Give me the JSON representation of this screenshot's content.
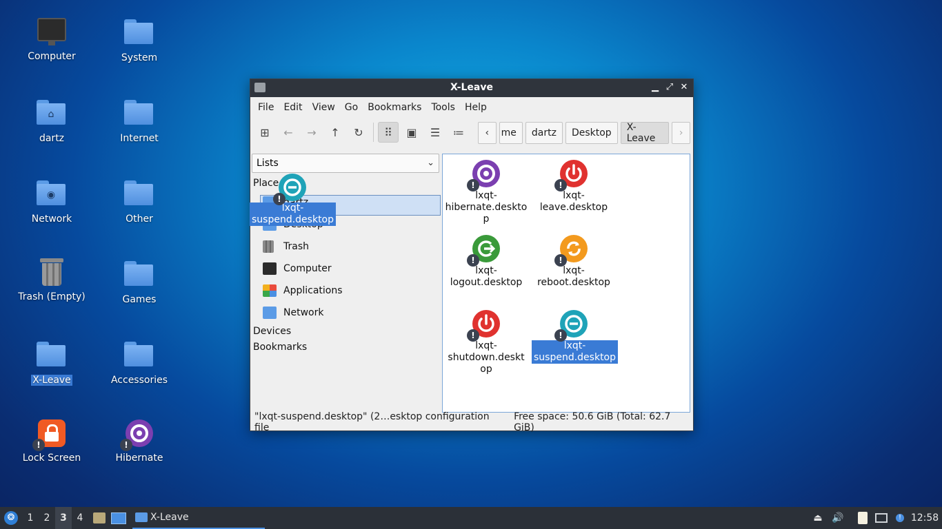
{
  "desktop": {
    "icons": [
      {
        "label": "Computer",
        "icon": "computer-icon"
      },
      {
        "label": "System",
        "icon": "folder-icon"
      },
      {
        "label": "dartz",
        "icon": "home-folder-icon"
      },
      {
        "label": "Internet",
        "icon": "folder-icon"
      },
      {
        "label": "Network",
        "icon": "network-folder-icon"
      },
      {
        "label": "Other",
        "icon": "folder-icon"
      },
      {
        "label": "Trash (Empty)",
        "icon": "trash-icon"
      },
      {
        "label": "Games",
        "icon": "folder-icon"
      },
      {
        "label": "X-Leave",
        "icon": "folder-icon"
      },
      {
        "label": "Accessories",
        "icon": "folder-icon"
      },
      {
        "label": "Lock Screen",
        "icon": "lock-icon"
      },
      {
        "label": "Hibernate",
        "icon": "hibernate-icon"
      }
    ]
  },
  "window": {
    "title": "X-Leave",
    "menu": [
      "File",
      "Edit",
      "View",
      "Go",
      "Bookmarks",
      "Tools",
      "Help"
    ],
    "breadcrumbs": [
      "me",
      "dartz",
      "Desktop",
      "X-Leave"
    ],
    "side_combo": "Lists",
    "places_label": "Place",
    "places": [
      {
        "label": "dartz"
      },
      {
        "label": "Desktop"
      },
      {
        "label": "Trash"
      },
      {
        "label": "Computer"
      },
      {
        "label": "Applications"
      },
      {
        "label": "Network"
      }
    ],
    "devices_label": "Devices",
    "bookmarks_label": "Bookmarks",
    "files": [
      {
        "line1": "lxqt-",
        "line2": "hibernate.deskto",
        "line3": "p",
        "color": "#7b3fb0"
      },
      {
        "line1": "lxqt-",
        "line2": "leave.desktop",
        "line3": "",
        "color": "#e0322f"
      },
      {
        "line1": "lxqt-",
        "line2": "logout.desktop",
        "line3": "",
        "color": "#3a9a3a"
      },
      {
        "line1": "lxqt-",
        "line2": "reboot.desktop",
        "line3": "",
        "color": "#f39a1e"
      },
      {
        "line1": "lxqt-",
        "line2": "shutdown.deskt",
        "line3": "op",
        "color": "#e0322f"
      },
      {
        "line1": "lxqt-",
        "line2": "suspend.desktop",
        "line3": "",
        "color": "#1fa3b8"
      }
    ],
    "status_left": "\"lxqt-suspend.desktop\" (2…esktop configuration file",
    "status_right": "Free space: 50.6 GiB (Total: 62.7 GiB)"
  },
  "drag_ghost": {
    "line1": "lxqt-",
    "line2": "suspend.desktop"
  },
  "taskbar": {
    "workspaces": [
      "1",
      "2",
      "3",
      "4"
    ],
    "task_label": "X-Leave",
    "clock": "12:58"
  }
}
